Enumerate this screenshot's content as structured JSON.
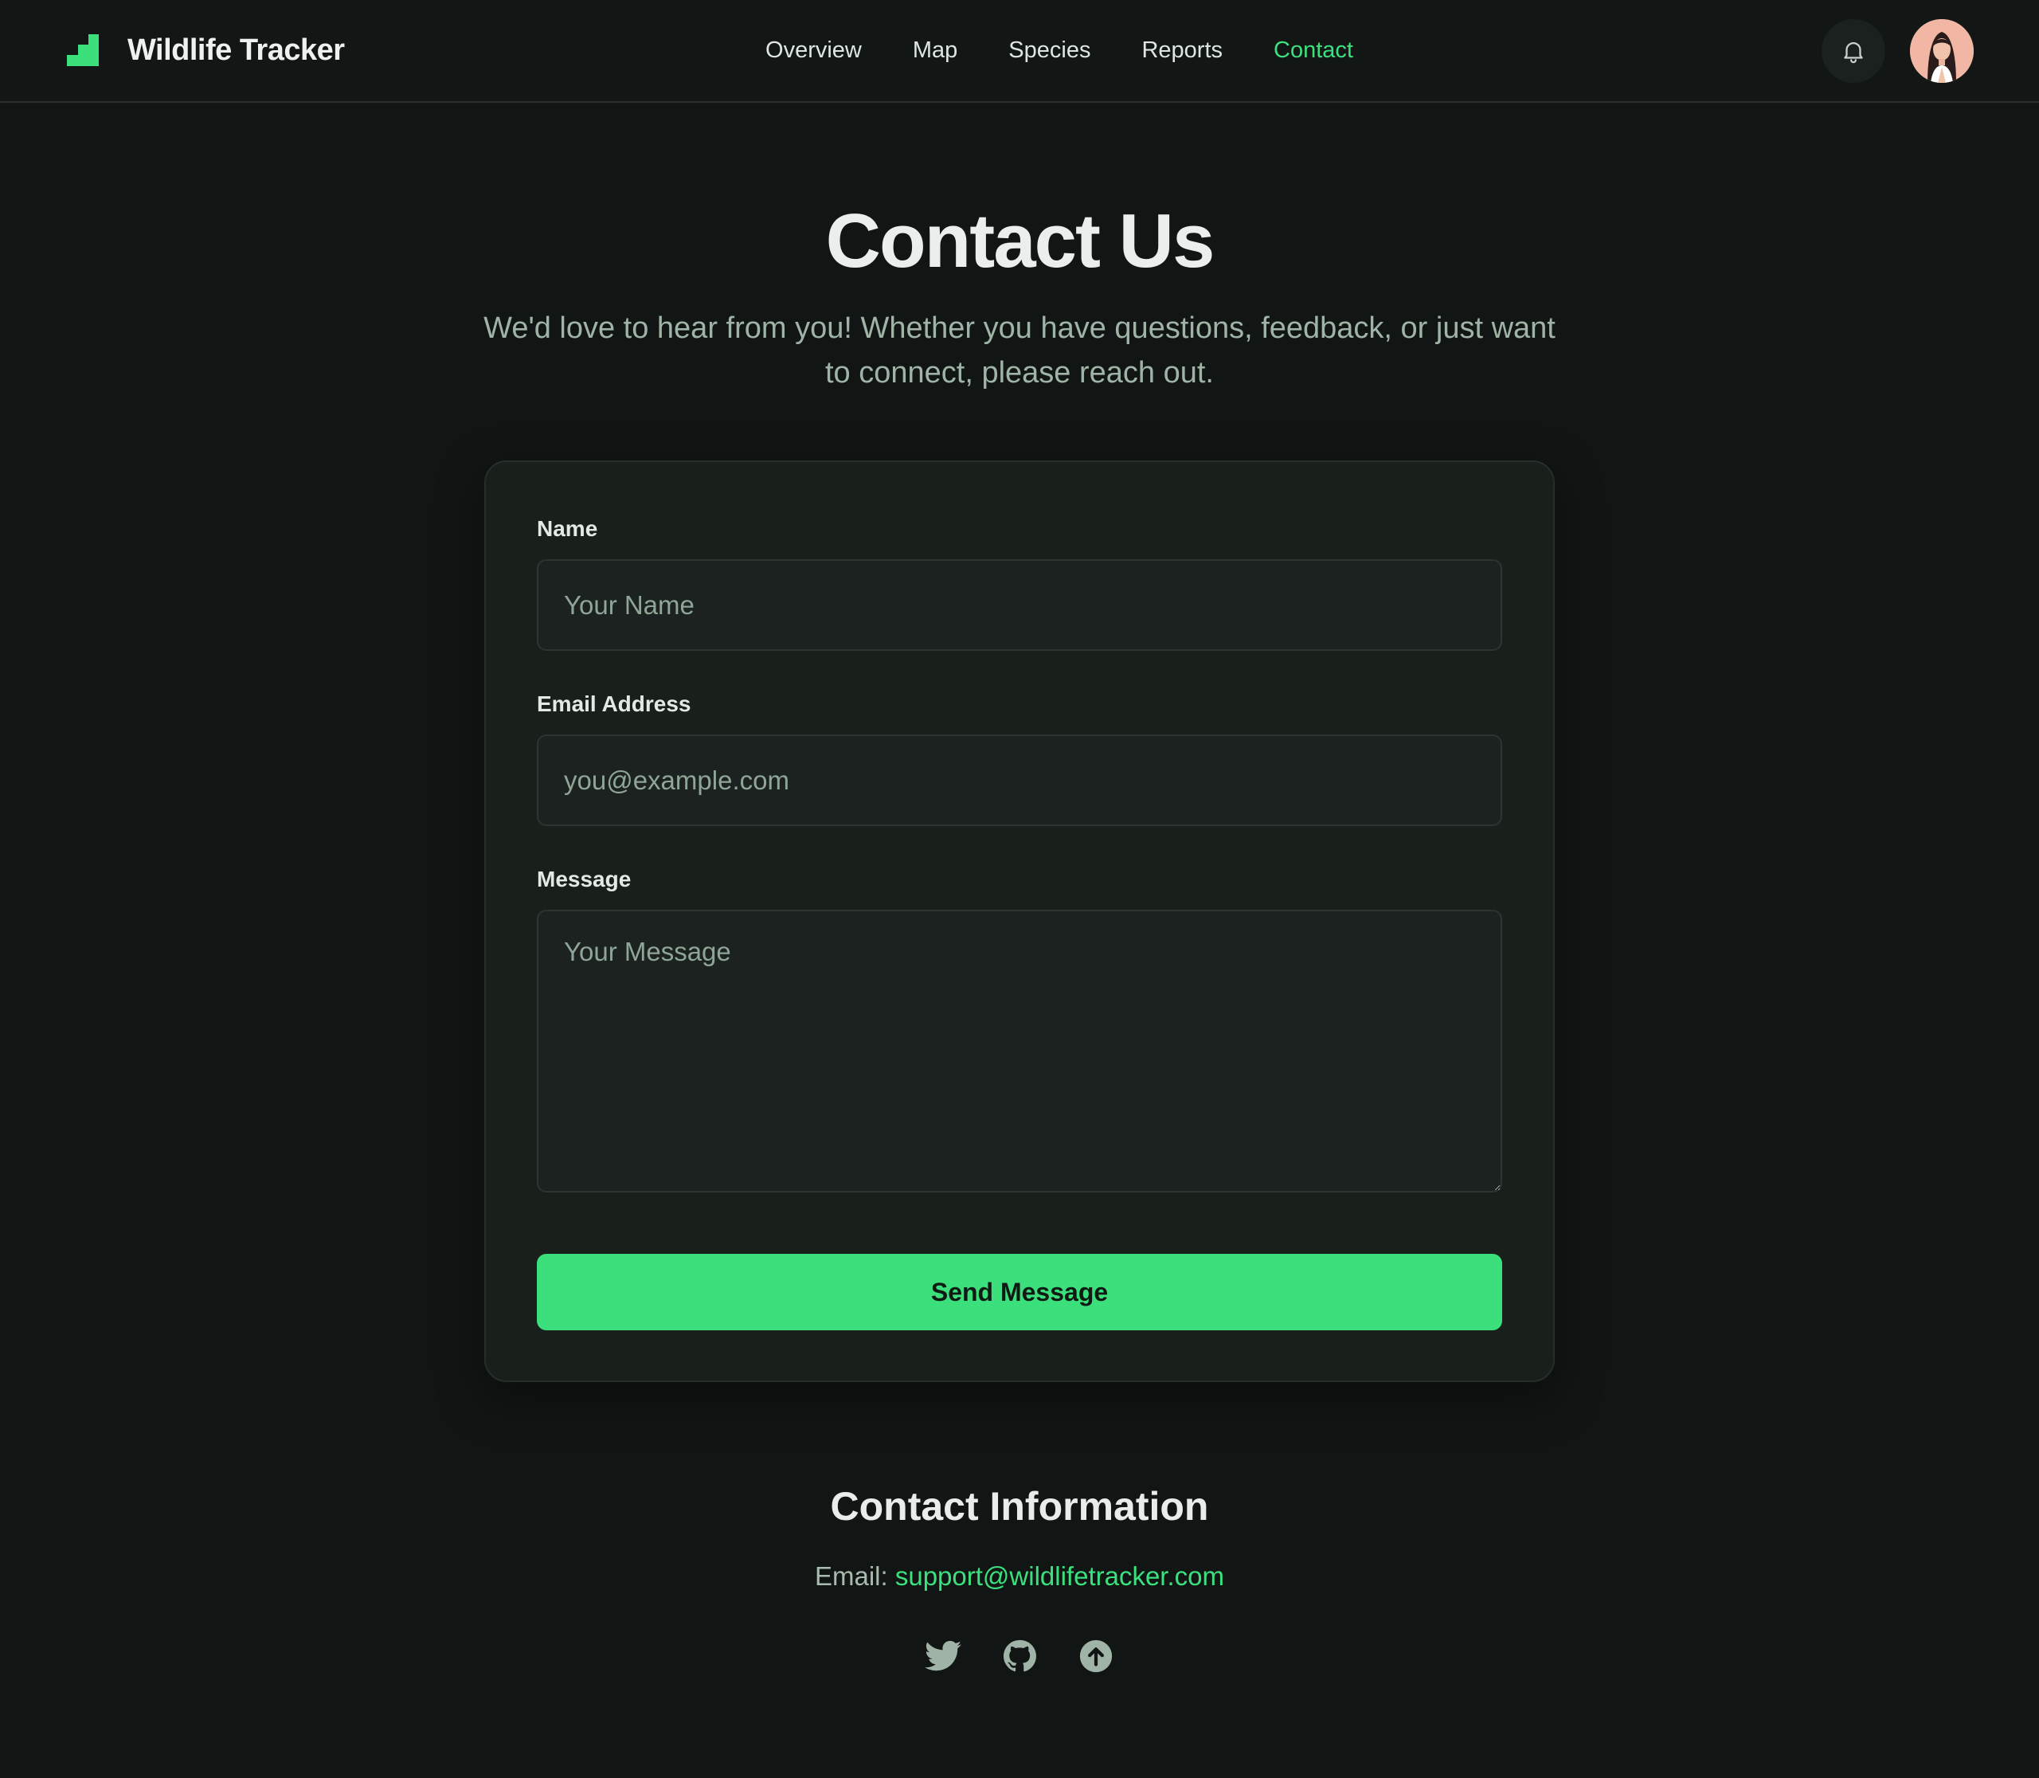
{
  "header": {
    "brand": "Wildlife Tracker",
    "nav": [
      {
        "label": "Overview",
        "active": false
      },
      {
        "label": "Map",
        "active": false
      },
      {
        "label": "Species",
        "active": false
      },
      {
        "label": "Reports",
        "active": false
      },
      {
        "label": "Contact",
        "active": true
      }
    ],
    "icons": {
      "notifications": "bell-icon",
      "profile": "avatar"
    }
  },
  "hero": {
    "title": "Contact Us",
    "subtitle": "We'd love to hear from you! Whether you have questions, feedback, or just want to connect, please reach out."
  },
  "form": {
    "name_label": "Name",
    "name_value": "",
    "name_placeholder": "Your Name",
    "email_label": "Email Address",
    "email_value": "",
    "email_placeholder": "you@example.com",
    "message_label": "Message",
    "message_value": "",
    "message_placeholder": "Your Message",
    "submit_label": "Send Message"
  },
  "contact_info": {
    "title": "Contact Information",
    "email_prefix": "Email: ",
    "email": "support@wildlifetracker.com",
    "socials": [
      "twitter-icon",
      "github-icon",
      "upload-icon"
    ]
  },
  "colors": {
    "background": "#111614",
    "card": "#19201c",
    "accent": "#3be07d",
    "muted_text": "#9fb3a6"
  }
}
